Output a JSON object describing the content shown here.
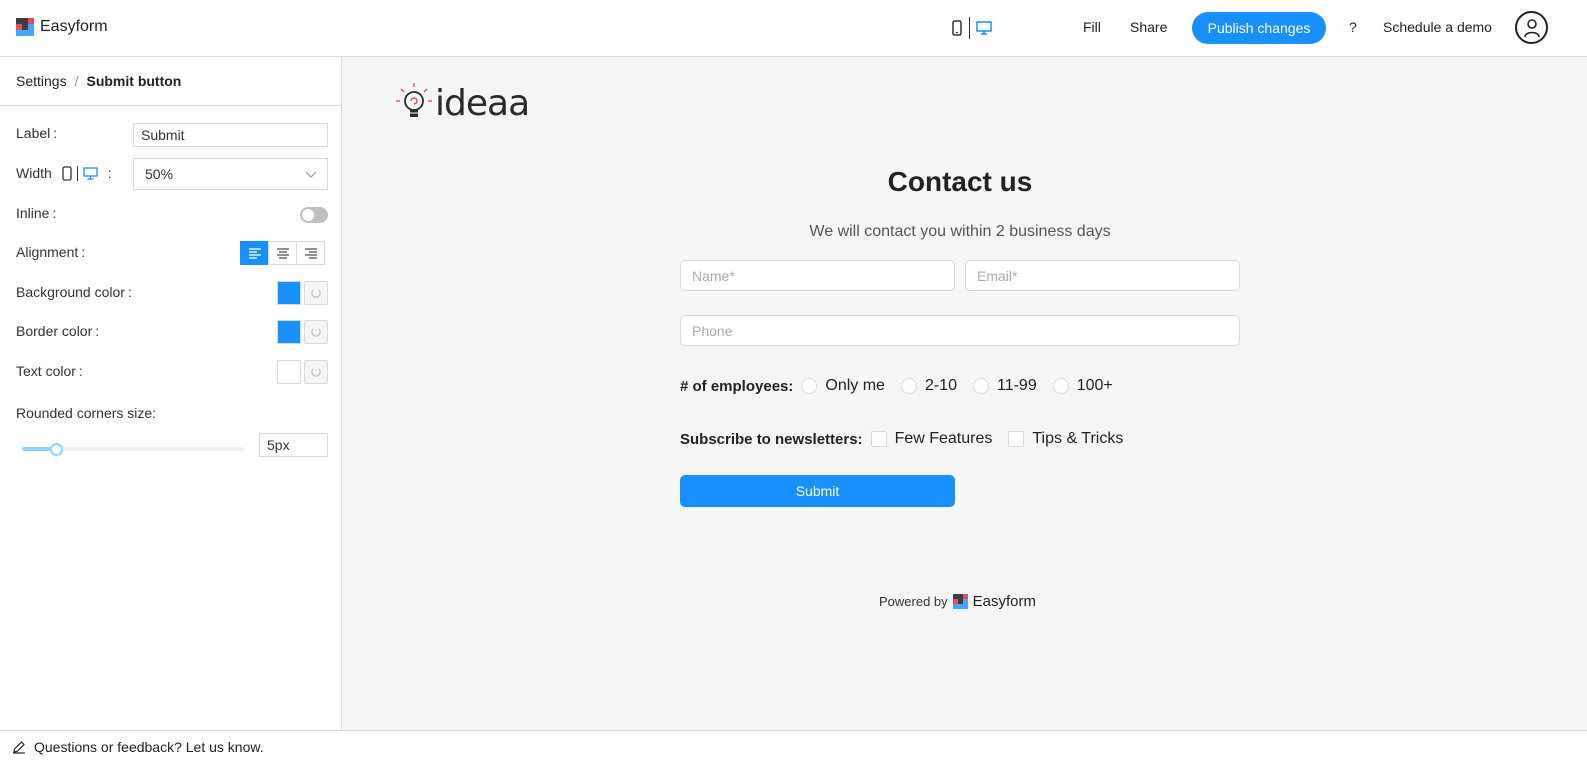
{
  "app": {
    "name": "Easyform"
  },
  "topbar": {
    "fill": "Fill",
    "share": "Share",
    "publish": "Publish changes",
    "help": "?",
    "demo": "Schedule a demo"
  },
  "settings": {
    "breadcrumb_root": "Settings",
    "breadcrumb_sep": "/",
    "breadcrumb_current": "Submit button",
    "label_label": "Label",
    "label_value": "Submit",
    "width_label": "Width",
    "width_value": "50%",
    "inline_label": "Inline",
    "inline_on": false,
    "alignment_label": "Alignment",
    "alignment_selected": "left",
    "bg_color_label": "Background color",
    "bg_color": "#1890ff",
    "border_color_label": "Border color",
    "border_color": "#1890ff",
    "text_color_label": "Text color",
    "text_color": "#ffffff",
    "corners_label": "Rounded corners size:",
    "corners_value": "5px",
    "colon": ":"
  },
  "form": {
    "logo_text": "ideaa",
    "title": "Contact us",
    "subtitle": "We will contact you within 2 business days",
    "name_placeholder": "Name*",
    "email_placeholder": "Email*",
    "phone_placeholder": "Phone",
    "employees_label": "# of employees:",
    "employee_options": [
      "Only me",
      "2-10",
      "11-99",
      "100+"
    ],
    "newsletter_label": "Subscribe to newsletters:",
    "newsletter_options": [
      "Few Features",
      "Tips & Tricks"
    ],
    "submit": "Submit",
    "powered_by": "Powered by",
    "powered_brand": "Easyform"
  },
  "footer": {
    "feedback": "Questions or feedback? Let us know."
  },
  "colors": {
    "accent": "#1890ff"
  }
}
